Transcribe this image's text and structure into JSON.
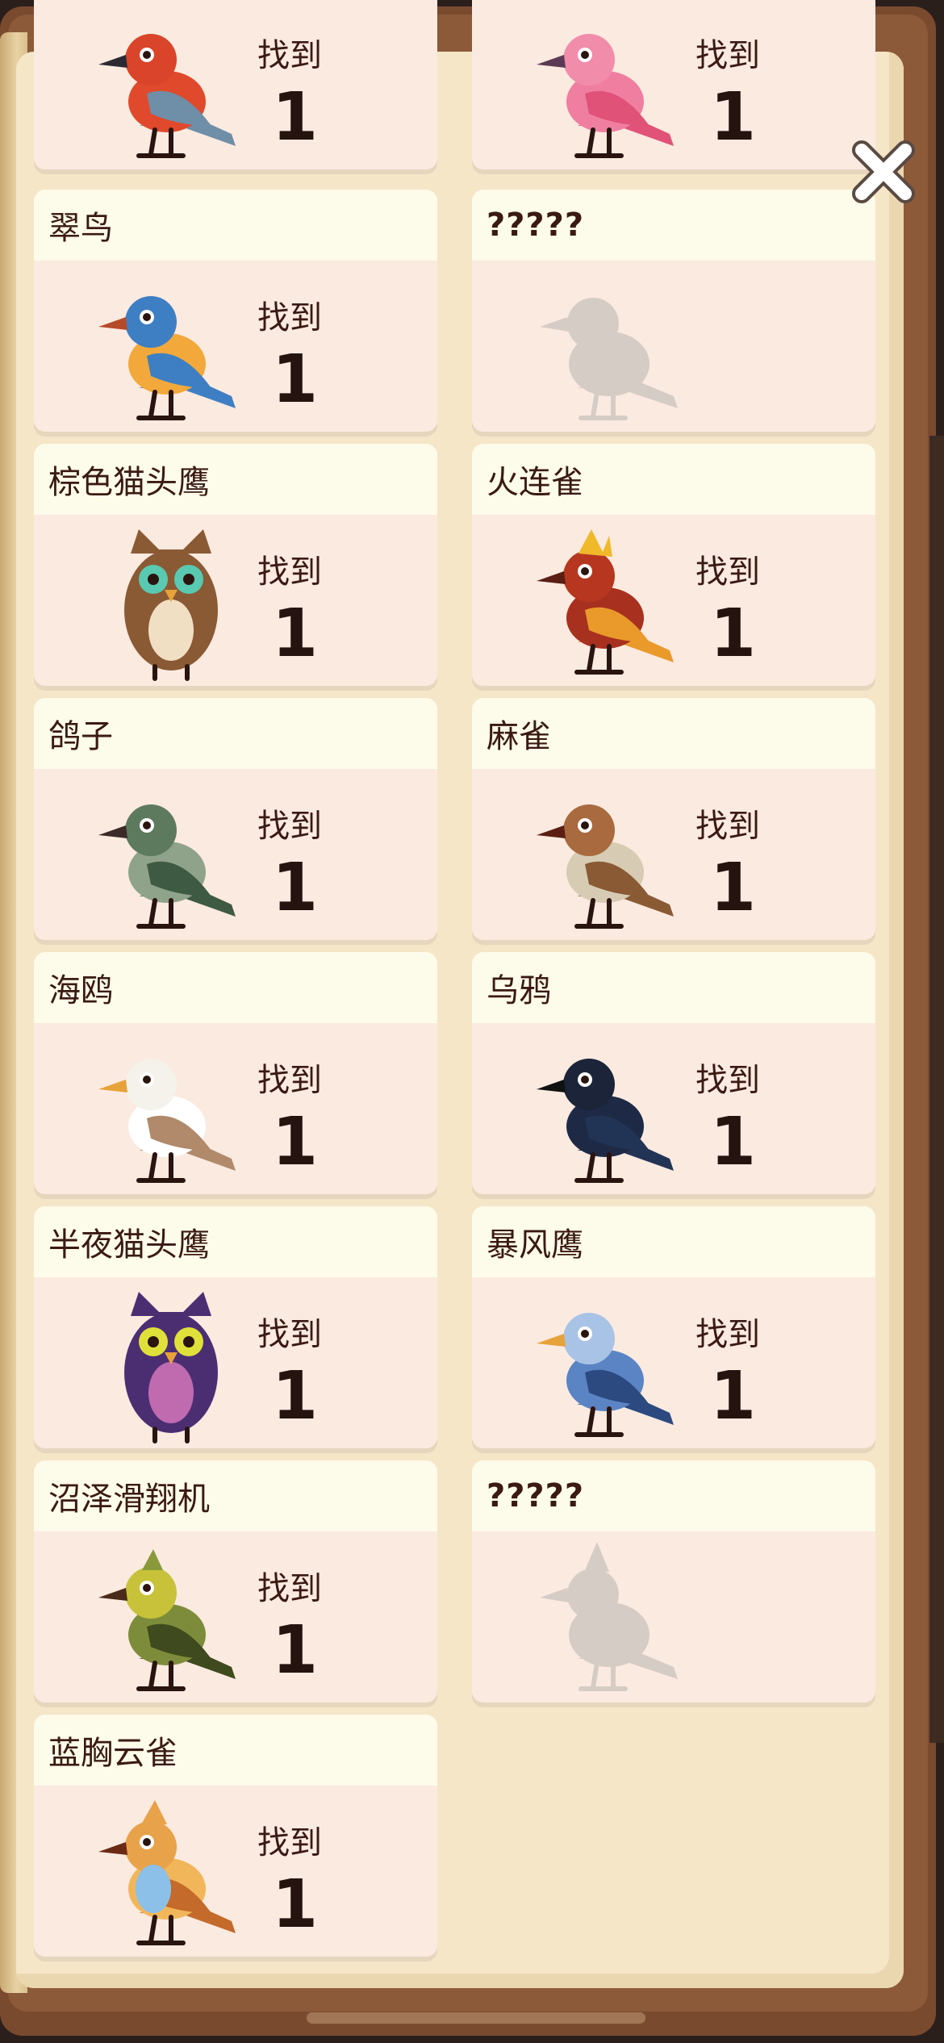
{
  "found_label": "找到",
  "cards": [
    {
      "name": "",
      "count": "1",
      "bird": "red-bird",
      "unknown": false
    },
    {
      "name": "",
      "count": "1",
      "bird": "pink-bird",
      "unknown": false
    },
    {
      "name": "翠鸟",
      "count": "1",
      "bird": "kingfisher",
      "unknown": false
    },
    {
      "name": "?????",
      "count": "",
      "bird": "silhouette-bird",
      "unknown": true
    },
    {
      "name": "棕色猫头鹰",
      "count": "1",
      "bird": "brown-owl",
      "unknown": false
    },
    {
      "name": "火连雀",
      "count": "1",
      "bird": "fire-waxwing",
      "unknown": false
    },
    {
      "name": "鸽子",
      "count": "1",
      "bird": "pigeon",
      "unknown": false
    },
    {
      "name": "麻雀",
      "count": "1",
      "bird": "sparrow",
      "unknown": false
    },
    {
      "name": "海鸥",
      "count": "1",
      "bird": "seagull",
      "unknown": false
    },
    {
      "name": "乌鸦",
      "count": "1",
      "bird": "crow",
      "unknown": false
    },
    {
      "name": "半夜猫头鹰",
      "count": "1",
      "bird": "midnight-owl",
      "unknown": false
    },
    {
      "name": "暴风鹰",
      "count": "1",
      "bird": "storm-hawk",
      "unknown": false
    },
    {
      "name": "沼泽滑翔机",
      "count": "1",
      "bird": "swamp-glider",
      "unknown": false
    },
    {
      "name": "?????",
      "count": "",
      "bird": "silhouette-crested-bird",
      "unknown": true
    },
    {
      "name": "蓝胸云雀",
      "count": "1",
      "bird": "blue-breast-lark",
      "unknown": false
    }
  ],
  "colors": {
    "card_head": "#fdfbea",
    "card_body": "#fbeae0",
    "text": "#3a1a12",
    "page": "#f5e6c8",
    "frame": "#7a4a2f"
  }
}
